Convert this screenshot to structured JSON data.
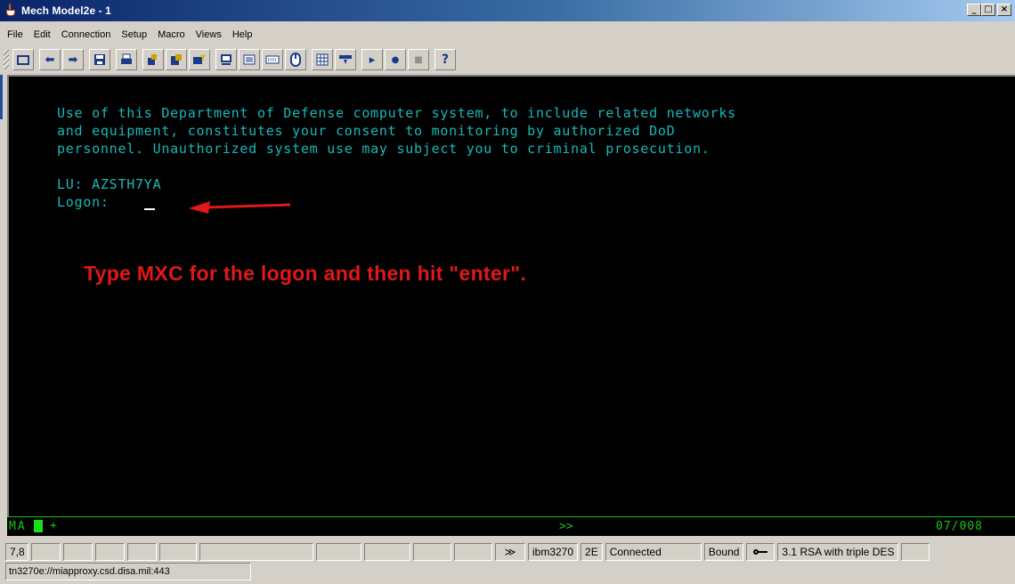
{
  "window": {
    "title": "Mech Model2e - 1",
    "controls": {
      "minimize": "_",
      "maximize": "□",
      "close": "×"
    }
  },
  "menu": [
    "File",
    "Edit",
    "Connection",
    "Setup",
    "Macro",
    "Views",
    "Help"
  ],
  "toolbar": {
    "icons": [
      "display-icon",
      "arrow-left-icon",
      "arrow-right-icon",
      "save-icon",
      "print-icon",
      "copy-icon",
      "paste-icon",
      "edit-icon",
      "screen-icon",
      "keypad-icon",
      "keyboard-icon",
      "mouse-icon",
      "grid-icon",
      "transfer-icon",
      "play-icon",
      "record-icon",
      "stop-icon",
      "help-icon"
    ],
    "glyphs": {
      "arrow_left": "⬅",
      "arrow_right": "➡",
      "play": "▸",
      "record": "●",
      "stop": "■",
      "help": "?"
    }
  },
  "terminal": {
    "lines": [
      "Use of this Department of Defense computer system, to include related networks",
      "and equipment, constitutes your consent to monitoring by authorized DoD",
      "personnel. Unauthorized system use may subject you to criminal prosecution."
    ],
    "lu": "LU: AZSTH7YA",
    "logon_prompt": "Logon:",
    "instruction": "Type MXC for the logon and then hit \"enter\".",
    "colors": {
      "text": "#19b8b8",
      "instruction": "#e01818",
      "arrow": "#e01818"
    }
  },
  "oia": {
    "ma": "MA",
    "plus": "+",
    "chevrons": ">>",
    "cursor_pos": "07/008"
  },
  "status": {
    "cursor": "7,8",
    "chevrons": "≫",
    "terminal_type": "ibm3270",
    "model": "2E",
    "connection": "Connected",
    "bound": "Bound",
    "security": "3.1 RSA with triple DES",
    "url": "tn3270e://miapproxy.csd.disa.mil:443"
  }
}
